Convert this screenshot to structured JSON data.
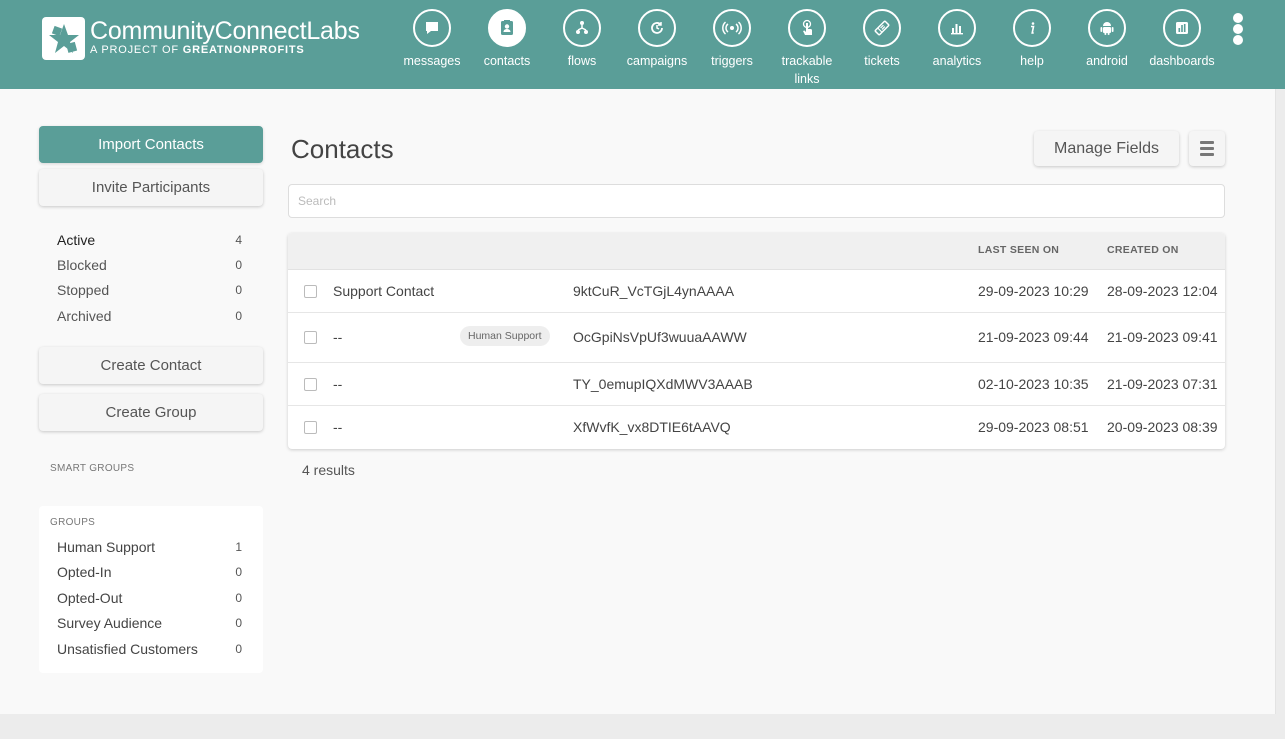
{
  "brand": {
    "name_bold": "CommunityConnect",
    "name_light": "Labs",
    "tagline_prefix": "A PROJECT OF ",
    "tagline_org": "GREATNONPROFITS",
    "color": "#5a9e98"
  },
  "nav": [
    {
      "label": "messages",
      "icon": "chat-bubble-icon"
    },
    {
      "label": "contacts",
      "icon": "contact-card-icon",
      "active": true
    },
    {
      "label": "flows",
      "icon": "flow-tree-icon"
    },
    {
      "label": "campaigns",
      "icon": "campaign-clock-icon"
    },
    {
      "label": "triggers",
      "icon": "broadcast-icon"
    },
    {
      "label": "trackable links",
      "label_line1": "trackable",
      "label_line2": "links",
      "icon": "pointer-hand-icon"
    },
    {
      "label": "tickets",
      "icon": "ticket-icon"
    },
    {
      "label": "analytics",
      "icon": "bar-chart-icon"
    },
    {
      "label": "help",
      "icon": "info-icon"
    },
    {
      "label": "android",
      "icon": "android-icon"
    },
    {
      "label": "dashboards",
      "icon": "dashboard-icon"
    }
  ],
  "sidebar": {
    "import_label": "Import Contacts",
    "invite_label": "Invite Participants",
    "statuses": [
      {
        "label": "Active",
        "count": "4"
      },
      {
        "label": "Blocked",
        "count": "0"
      },
      {
        "label": "Stopped",
        "count": "0"
      },
      {
        "label": "Archived",
        "count": "0"
      }
    ],
    "create_contact_label": "Create Contact",
    "create_group_label": "Create Group",
    "smart_groups_title": "SMART GROUPS",
    "groups_title": "GROUPS",
    "groups": [
      {
        "label": "Human Support",
        "count": "1"
      },
      {
        "label": "Opted-In",
        "count": "0"
      },
      {
        "label": "Opted-Out",
        "count": "0"
      },
      {
        "label": "Survey Audience",
        "count": "0"
      },
      {
        "label": "Unsatisfied Customers",
        "count": "0"
      }
    ]
  },
  "main": {
    "title": "Contacts",
    "manage_fields_label": "Manage Fields",
    "search_placeholder": "Search",
    "columns": {
      "last_seen": "LAST SEEN ON",
      "created": "CREATED ON"
    },
    "rows": [
      {
        "name": "Support Contact",
        "tag": "",
        "urn": "9ktCuR_VcTGjL4ynAAAA",
        "last_seen": "29-09-2023 10:29",
        "created": "28-09-2023 12:04"
      },
      {
        "name": "--",
        "tag": "Human Support",
        "urn": "OcGpiNsVpUf3wuuaAAWW",
        "last_seen": "21-09-2023 09:44",
        "created": "21-09-2023 09:41"
      },
      {
        "name": "--",
        "tag": "",
        "urn": "TY_0emupIQXdMWV3AAAB",
        "last_seen": "02-10-2023 10:35",
        "created": "21-09-2023 07:31"
      },
      {
        "name": "--",
        "tag": "",
        "urn": "XfWvfK_vx8DTIE6tAAVQ",
        "last_seen": "29-09-2023 08:51",
        "created": "20-09-2023 08:39"
      }
    ],
    "results_text": "4 results"
  }
}
